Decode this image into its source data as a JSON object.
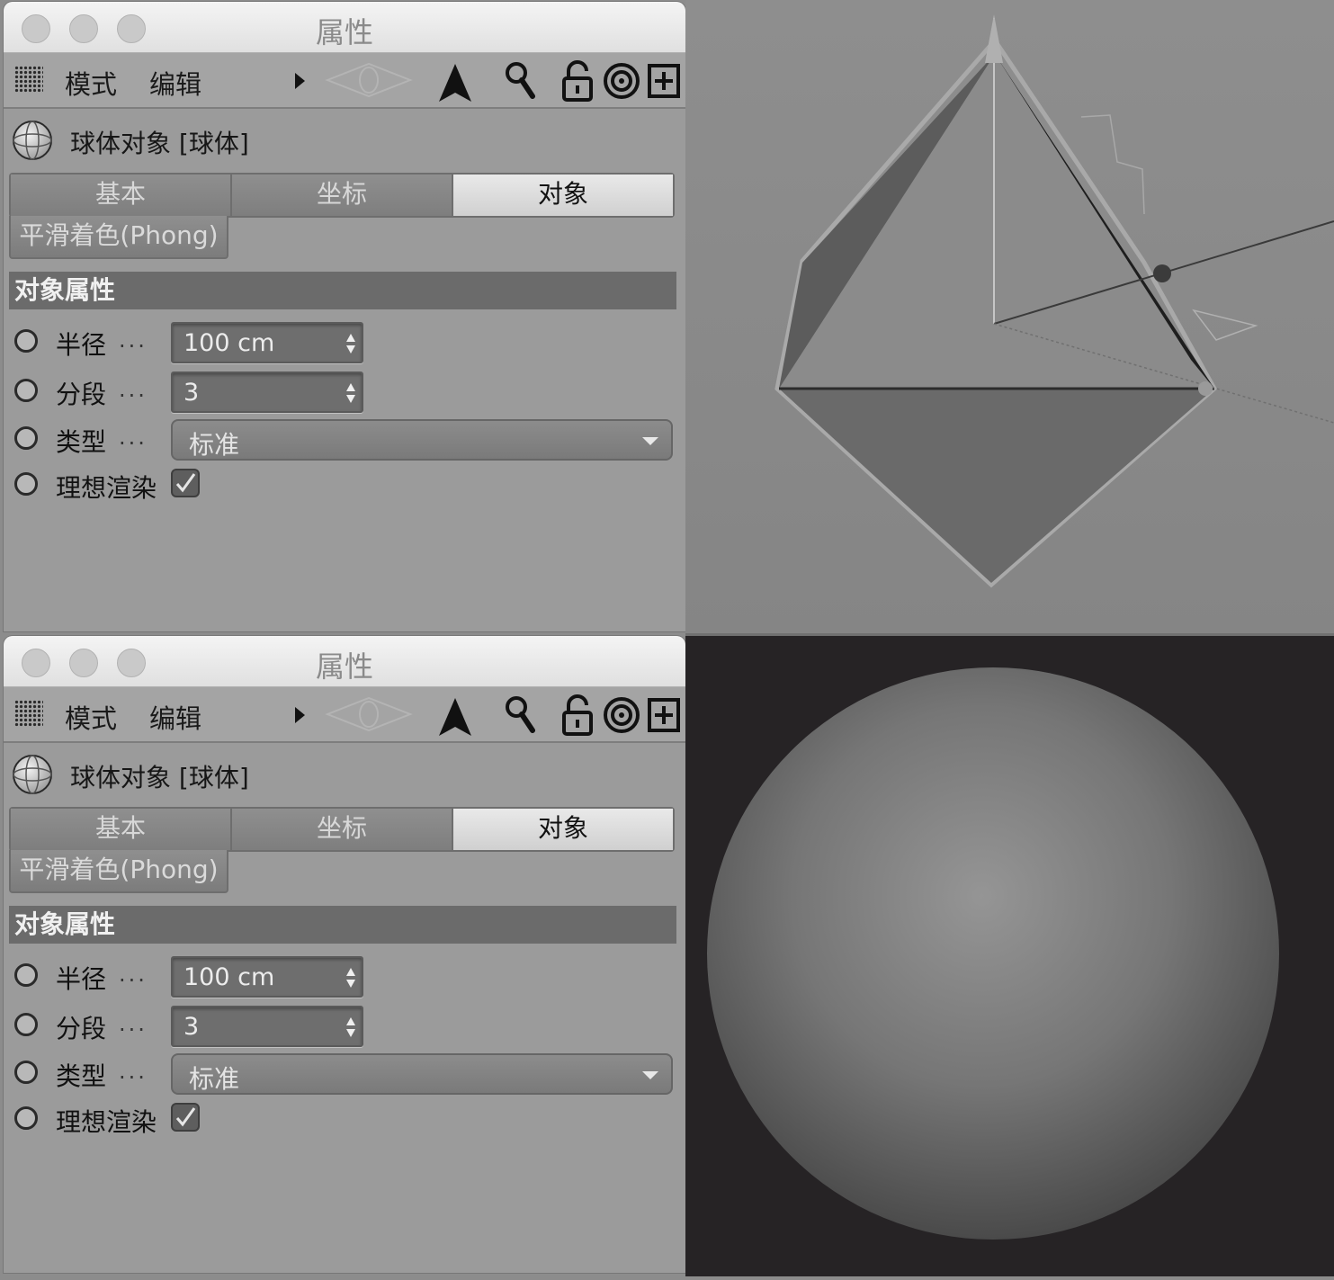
{
  "panels": [
    {
      "window_title": "属性",
      "menu": {
        "mode": "模式",
        "edit": "编辑"
      },
      "object_title": "球体对象 [球体]",
      "tabs": {
        "basic": "基本",
        "coord": "坐标",
        "object": "对象",
        "phong": "平滑着色(Phong)"
      },
      "active_tab": "对象",
      "section_title": "对象属性",
      "params": {
        "radius": {
          "label": "半径",
          "dots": "...",
          "value": "100 cm"
        },
        "segments": {
          "label": "分段",
          "dots": "...",
          "value": "3"
        },
        "type": {
          "label": "类型",
          "dots": "...",
          "value": "标准"
        },
        "render_perfect": {
          "label": "理想渲染",
          "checked": true
        }
      }
    },
    {
      "window_title": "属性",
      "menu": {
        "mode": "模式",
        "edit": "编辑"
      },
      "object_title": "球体对象 [球体]",
      "tabs": {
        "basic": "基本",
        "coord": "坐标",
        "object": "对象",
        "phong": "平滑着色(Phong)"
      },
      "active_tab": "对象",
      "section_title": "对象属性",
      "params": {
        "radius": {
          "label": "半径",
          "dots": "...",
          "value": "100 cm"
        },
        "segments": {
          "label": "分段",
          "dots": "...",
          "value": "3"
        },
        "type": {
          "label": "类型",
          "dots": "...",
          "value": "标准"
        },
        "render_perfect": {
          "label": "理想渲染",
          "checked": true
        }
      }
    }
  ],
  "viewports": {
    "top": {
      "content": "octahedron-wireframe-with-axes"
    },
    "bottom": {
      "content": "rendered-smooth-sphere"
    }
  },
  "colors": {
    "panel_bg": "#9b9b9b",
    "section_bg": "#6b6b6b",
    "render_bg": "#262325"
  }
}
